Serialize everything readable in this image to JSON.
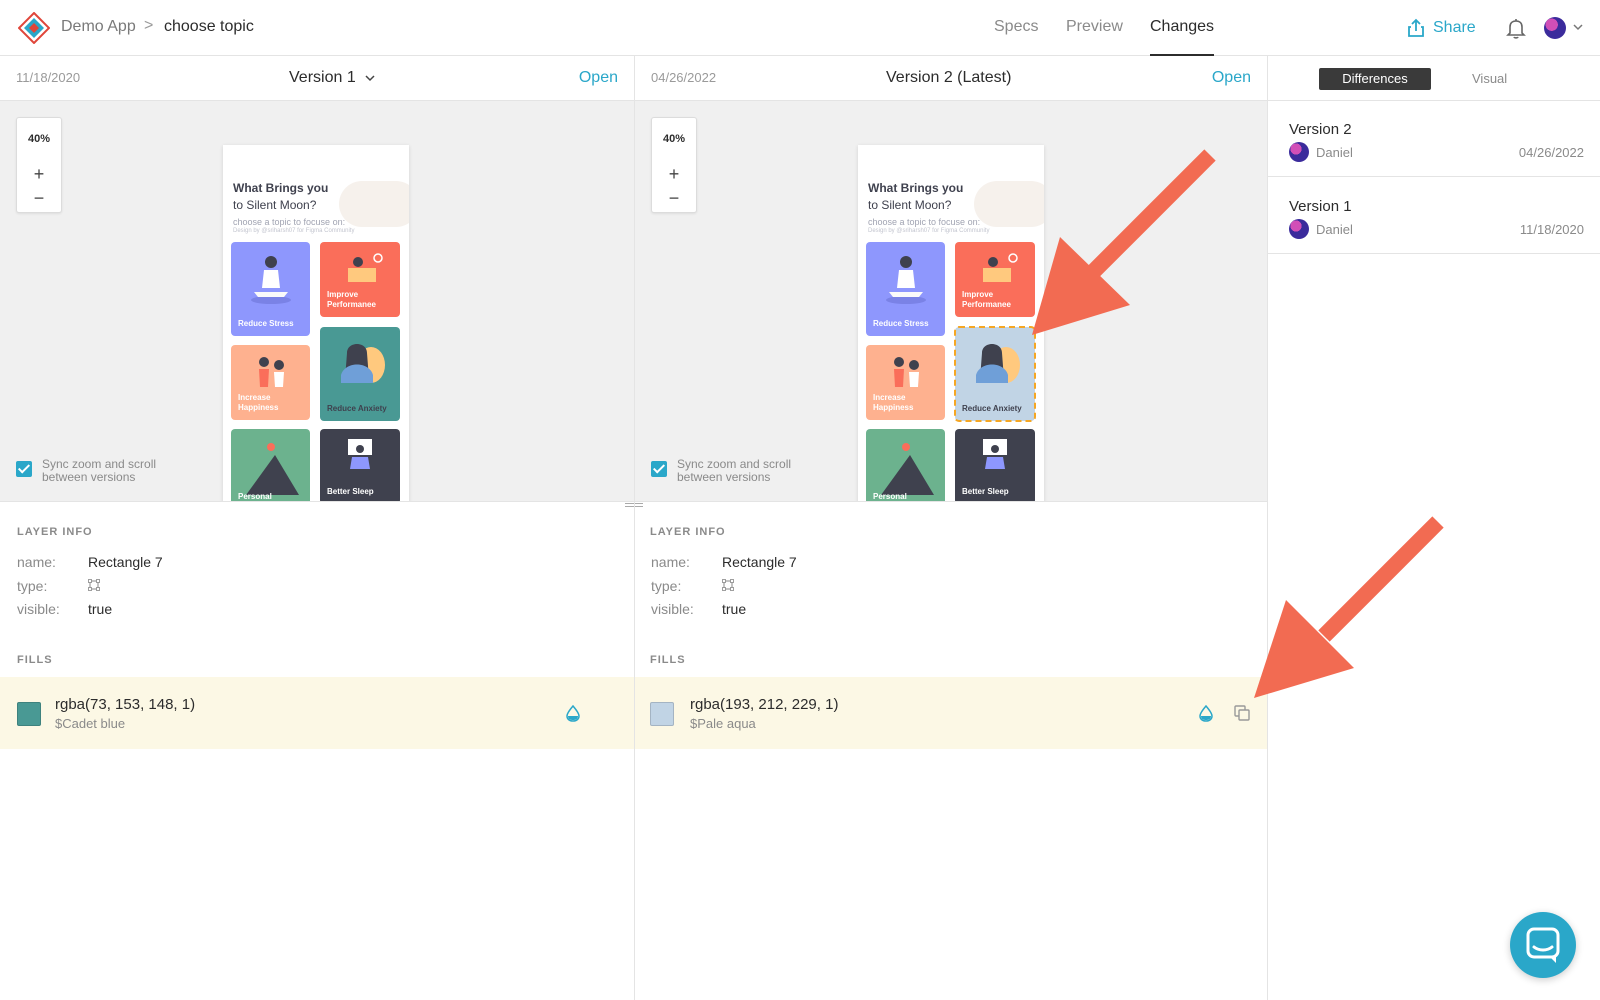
{
  "header": {
    "app_name": "Demo App",
    "separator": ">",
    "page_name": "choose topic",
    "tabs": [
      "Specs",
      "Preview",
      "Changes"
    ],
    "active_tab": "Changes",
    "share_label": "Share"
  },
  "left_version": {
    "date": "11/18/2020",
    "name": "Version 1",
    "open_label": "Open",
    "zoom": "40%",
    "zoom_in": "+",
    "zoom_out": "−",
    "sync_label": "Sync zoom and scroll between versions",
    "mockup": {
      "title_line1": "What Brings you",
      "title_line2": "to Silent Moon?",
      "subtitle": "choose a topic to focuse on:",
      "credit": "Design by @sriharsh07 for Figma Community",
      "cards": [
        "Reduce Stress",
        "Improve Performanee",
        "Increase Happiness",
        "Reduce Anxiety",
        "Personal",
        "Better Sleep"
      ]
    },
    "layer_info": {
      "title": "LAYER INFO",
      "name_key": "name:",
      "name_val": "Rectangle 7",
      "type_key": "type:",
      "visible_key": "visible:",
      "visible_val": "true"
    },
    "fills": {
      "title": "FILLS",
      "rgba": "rgba(73, 153, 148, 1)",
      "token": "$Cadet blue",
      "color": "#499994"
    }
  },
  "right_version": {
    "date": "04/26/2022",
    "name": "Version 2 (Latest)",
    "open_label": "Open",
    "zoom": "40%",
    "zoom_in": "+",
    "zoom_out": "−",
    "sync_label": "Sync zoom and scroll between versions",
    "mockup": {
      "title_line1": "What Brings you",
      "title_line2": "to Silent Moon?",
      "subtitle": "choose a topic to focuse on:",
      "credit": "Design by @sriharsh07 for Figma Community",
      "cards": [
        "Reduce Stress",
        "Improve Performanee",
        "Increase Happiness",
        "Reduce Anxiety",
        "Personal",
        "Better Sleep"
      ]
    },
    "layer_info": {
      "title": "LAYER INFO",
      "name_key": "name:",
      "name_val": "Rectangle 7",
      "type_key": "type:",
      "visible_key": "visible:",
      "visible_val": "true"
    },
    "fills": {
      "title": "FILLS",
      "rgba": "rgba(193, 212, 229, 1)",
      "token": "$Pale aqua",
      "color": "#c1d4e5"
    }
  },
  "sidebar": {
    "tab_active": "Differences",
    "tab_inactive": "Visual",
    "versions": [
      {
        "title": "Version 2",
        "author": "Daniel",
        "date": "04/26/2022"
      },
      {
        "title": "Version 1",
        "author": "Daniel",
        "date": "11/18/2020"
      }
    ]
  },
  "colors": {
    "accent": "#2aa7c9",
    "highlight_row": "#fcf8e5",
    "annotation_arrow": "#f26b52",
    "card_reduce_stress": "#8e97fd",
    "card_improve": "#fa6e5a",
    "card_happiness": "#feb18f",
    "card_anxiety_v1": "#499994",
    "card_anxiety_v2": "#c1d4e5",
    "card_personal": "#6cb28e",
    "card_sleep": "#3f414e"
  }
}
